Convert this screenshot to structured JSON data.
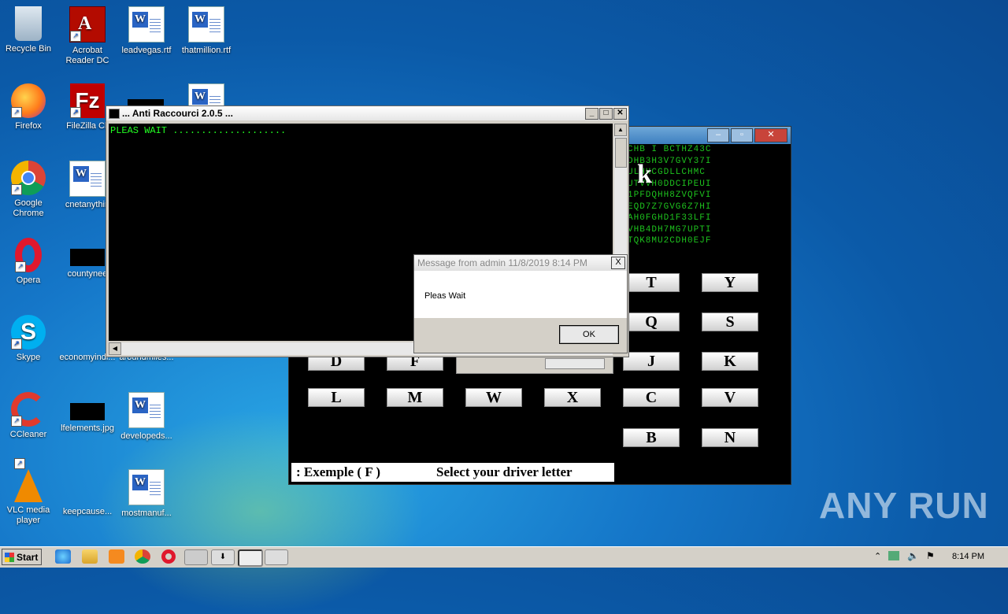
{
  "desktop": {
    "icons": [
      {
        "name": "recycle-bin-icon",
        "label": "Recycle Bin",
        "x": 0
      },
      {
        "name": "acrobat-icon",
        "label": "Acrobat Reader DC"
      },
      {
        "name": "word-doc-icon",
        "label": "leadvegas.rtf"
      },
      {
        "name": "word-doc-icon",
        "label": "thatmillion.rtf"
      },
      {
        "name": "firefox-icon",
        "label": "Firefox"
      },
      {
        "name": "filezilla-icon",
        "label": "FileZilla Cli"
      },
      {
        "name": "chrome-icon",
        "label": "Google Chrome"
      },
      {
        "name": "word-doc-icon",
        "label": "cnetanythin"
      },
      {
        "name": "opera-icon",
        "label": "Opera"
      },
      {
        "name": "image-icon",
        "label": "countynee"
      },
      {
        "name": "skype-icon",
        "label": "Skype"
      },
      {
        "name": "file-icon",
        "label": "economyindi..."
      },
      {
        "name": "file-icon",
        "label": "aroundmiles..."
      },
      {
        "name": "ccleaner-icon",
        "label": "CCleaner"
      },
      {
        "name": "image-icon",
        "label": "lfelements.jpg"
      },
      {
        "name": "word-doc-icon",
        "label": "developeds..."
      },
      {
        "name": "vlc-icon",
        "label": "VLC media player"
      },
      {
        "name": "file-icon",
        "label": "keepcause..."
      },
      {
        "name": "word-doc-icon",
        "label": "mostmanuf..."
      }
    ]
  },
  "console": {
    "title": "... Anti Raccourci 2.0.5  ...",
    "text": "PLEAS WAIT ...................."
  },
  "app": {
    "matrix_lines": [
      "CHB  I BCTHZ43C",
      "DHB3H3V7GVY37I",
      "ULHHCGDLLCHMC",
      "UTVVH0DDCIPEUI",
      "1PFDQHH8ZVQFVI",
      "EQD7Z7GVG6Z7HI",
      "AH0FGHD1F33LFI",
      "VHB4DH7MG7UPTI",
      "TQK8MU2CDH0EJF"
    ],
    "big_letter": "k",
    "keys": [
      "T",
      "Y",
      "Q",
      "S",
      "D",
      "F",
      "J",
      "K",
      "L",
      "M",
      "W",
      "X",
      "C",
      "V",
      "B",
      "N"
    ],
    "example_text": ": Exemple ( F )",
    "select_text": "Select your driver letter"
  },
  "msgbox": {
    "title": "Message from admin 11/8/2019 8:14 PM",
    "body": "Pleas Wait",
    "ok": "OK",
    "close": "X"
  },
  "taskbar": {
    "start": "Start",
    "clock": "8:14 PM"
  },
  "watermark": "ANY RUN"
}
